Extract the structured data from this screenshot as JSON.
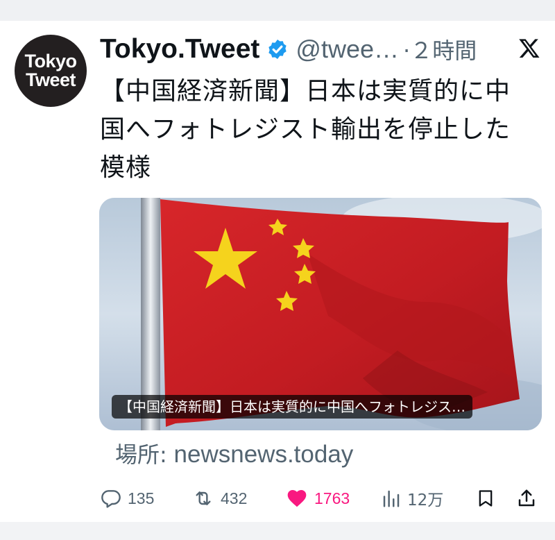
{
  "avatar": {
    "line1": "Tokyo",
    "line2": "Tweet"
  },
  "author": {
    "name": "Tokyo.Tweet",
    "handle": "@twee…",
    "time": "·２時間",
    "verified_color": "#1d9bf0"
  },
  "tweet": {
    "line1": "【中国経済新聞】日本は実質的に中",
    "line2": "国へフォトレジスト輸出を停止した",
    "line3": "模様"
  },
  "media": {
    "caption": "【中国経済新聞】日本は実質的に中国へフォトレジス…",
    "icon": "flag-photo"
  },
  "link": {
    "prefix": "場所:",
    "domain": "newsnews.today"
  },
  "actions": {
    "replies": "135",
    "reposts": "432",
    "likes": "1763",
    "views": "12万",
    "like_color": "#f91880"
  }
}
